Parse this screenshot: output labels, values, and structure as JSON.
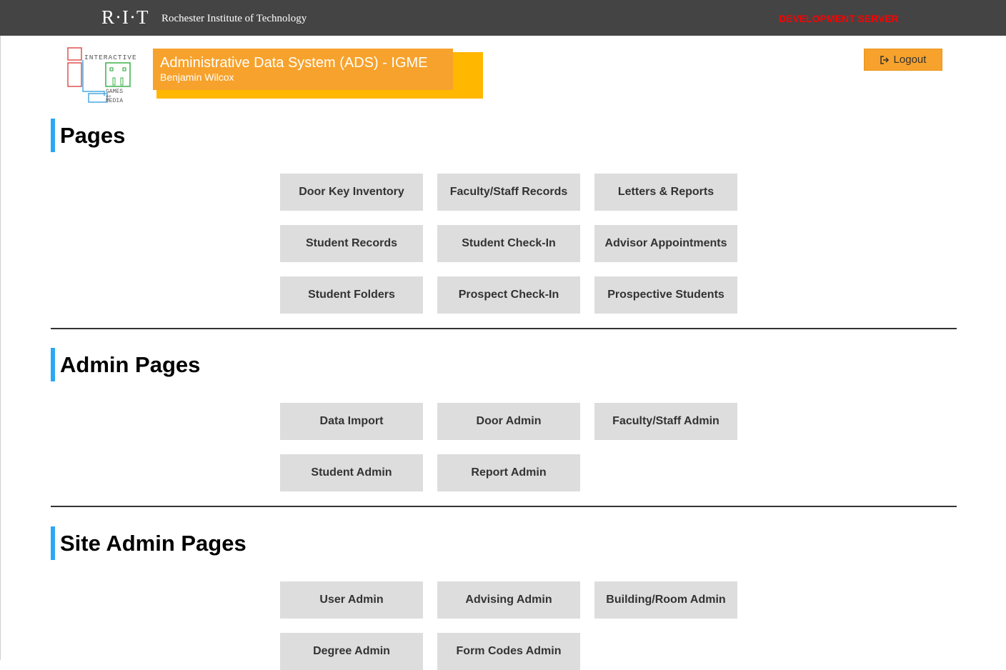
{
  "header": {
    "rit_logo": "R·I·T",
    "rit_name": "Rochester Institute of Technology",
    "server_label": "DEVELOPMENT SERVER"
  },
  "branding": {
    "logo_text_top": "INTERACTIVE",
    "logo_text_games": "GAMES",
    "logo_text_and": "AND",
    "logo_text_media": "MEDIA",
    "app_title": "Administrative Data System (ADS) - IGME",
    "user_name": "Benjamin Wilcox",
    "logout_label": "Logout"
  },
  "sections": {
    "pages": {
      "title": "Pages",
      "buttons": [
        "Door Key Inventory",
        "Faculty/Staff Records",
        "Letters & Reports",
        "Student Records",
        "Student Check-In",
        "Advisor Appointments",
        "Student Folders",
        "Prospect Check-In",
        "Prospective Students"
      ]
    },
    "admin": {
      "title": "Admin Pages",
      "buttons": [
        "Data Import",
        "Door Admin",
        "Faculty/Staff Admin",
        "Student Admin",
        "Report Admin"
      ]
    },
    "site_admin": {
      "title": "Site Admin Pages",
      "buttons": [
        "User Admin",
        "Advising Admin",
        "Building/Room Admin",
        "Degree Admin",
        "Form Codes Admin"
      ]
    }
  },
  "colors": {
    "top_bar": "#444444",
    "accent_orange": "#f7a22c",
    "accent_yellow": "#ffb700",
    "section_accent": "#2aa8f2",
    "button_bg": "#dddddd",
    "dev_server": "#ff0000"
  }
}
